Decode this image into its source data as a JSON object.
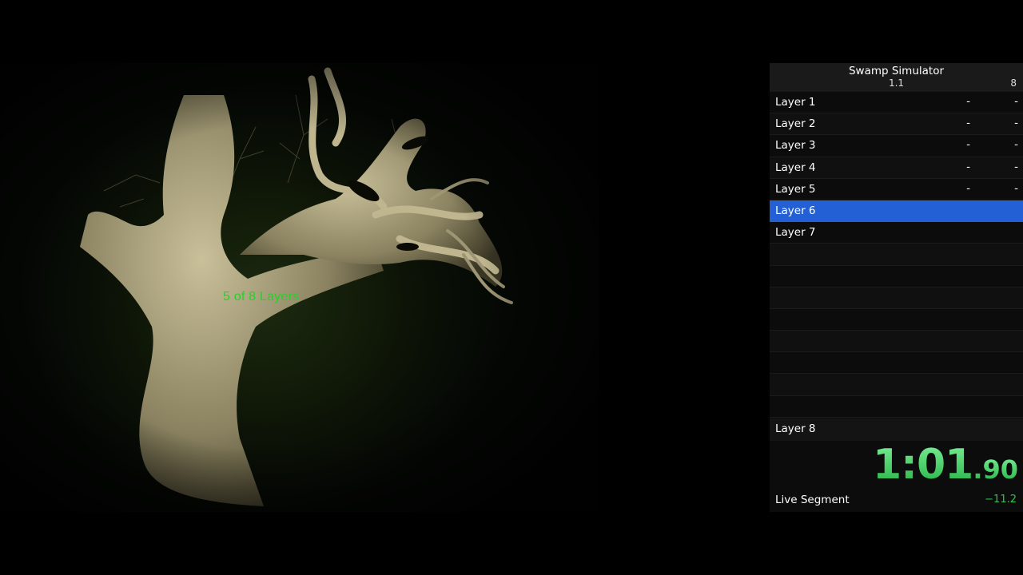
{
  "game_view": {
    "overlay_text": "5 of 8 Layers"
  },
  "splits": {
    "title": "Swamp Simulator",
    "category": "1.1",
    "attempts": "8",
    "rows": [
      {
        "name": "Layer 1",
        "delta": "-",
        "time": "-"
      },
      {
        "name": "Layer 2",
        "delta": "-",
        "time": "-"
      },
      {
        "name": "Layer 3",
        "delta": "-",
        "time": "-"
      },
      {
        "name": "Layer 4",
        "delta": "-",
        "time": "-"
      },
      {
        "name": "Layer 5",
        "delta": "-",
        "time": "-"
      },
      {
        "name": "Layer 6",
        "delta": "",
        "time": ""
      },
      {
        "name": "Layer 7",
        "delta": "",
        "time": ""
      }
    ],
    "current_index": 5,
    "last_split": "Layer 8",
    "timer_main": "1:01",
    "timer_ms": ".90",
    "live_segment_label": "Live Segment",
    "live_segment_value": "−11.2",
    "colors": {
      "current_row": "#2360d6",
      "timer_green": "#3fd46a",
      "delta_green": "#2fc44a",
      "overlay_green": "#26d12a"
    }
  }
}
